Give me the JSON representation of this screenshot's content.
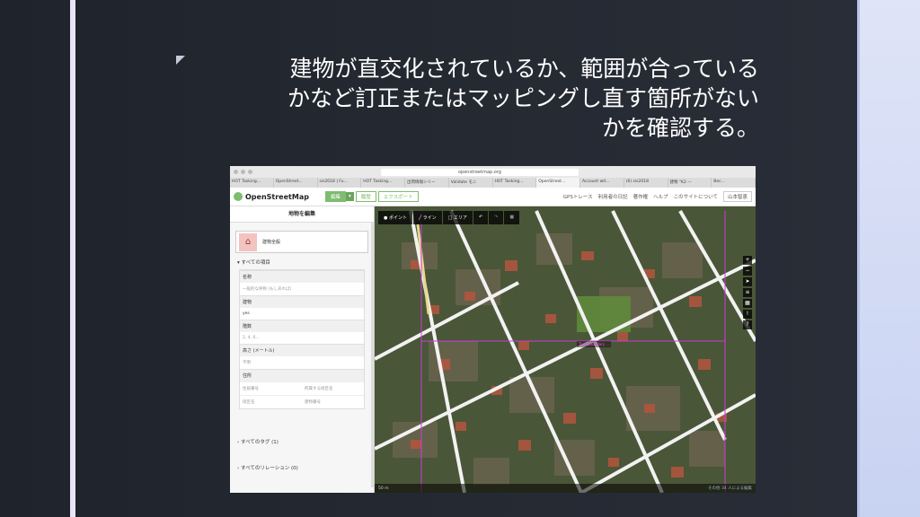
{
  "slide": {
    "title_lines": [
      "建物が直交化されているか、範囲が合っている",
      "かなど訂正またはマッピングし直す箇所がない",
      "かを確認する。"
    ]
  },
  "browser": {
    "url": "openstreetmap.org",
    "tabs": [
      "HOT Tasking...",
      "OpenStreet...",
      "sis2018 | Fu...",
      "HOT Tasking...",
      "出荷情報シリー",
      "Validate モニ",
      "HOT Tasking...",
      "OpenStreet...",
      "Account wit...",
      "(6) sis2018",
      "建物 \"K2 —",
      "Bec..."
    ]
  },
  "osm_nav": {
    "brand": "OpenStreetMap",
    "edit": "編集",
    "caret": "▾",
    "history": "履歴",
    "export": "エクスポート",
    "links": [
      "GPSトレース",
      "利用者の日記",
      "著作権",
      "ヘルプ",
      "このサイトについて"
    ],
    "user": "山本智恵"
  },
  "sidebar": {
    "header": "地物を編集",
    "preset_name": "建物全般",
    "all_fields": "すべての項目",
    "fields": [
      {
        "label": "名称",
        "value": "一般的な呼称 (もしあれば)",
        "filled": false
      },
      {
        "label": "建物",
        "value": "yes",
        "filled": true
      },
      {
        "label": "階数",
        "value": "2, 4, 6...",
        "filled": false
      },
      {
        "label": "高さ (メートル)",
        "value": "不明",
        "filled": false
      }
    ],
    "address_label": "住所",
    "address_cells": [
      "住居番号",
      "所属する街区名",
      "街区名",
      "建物番号"
    ],
    "all_tags": "すべてのタグ (1)",
    "all_relations": "すべてのリレーション (0)"
  },
  "map": {
    "tools": {
      "point": "ポイント",
      "line": "ライン",
      "area": "エリア"
    },
    "footer_scale": "50 m",
    "footer_attr": "その他 34 人による編集",
    "warning": "Task Boundary ..."
  }
}
